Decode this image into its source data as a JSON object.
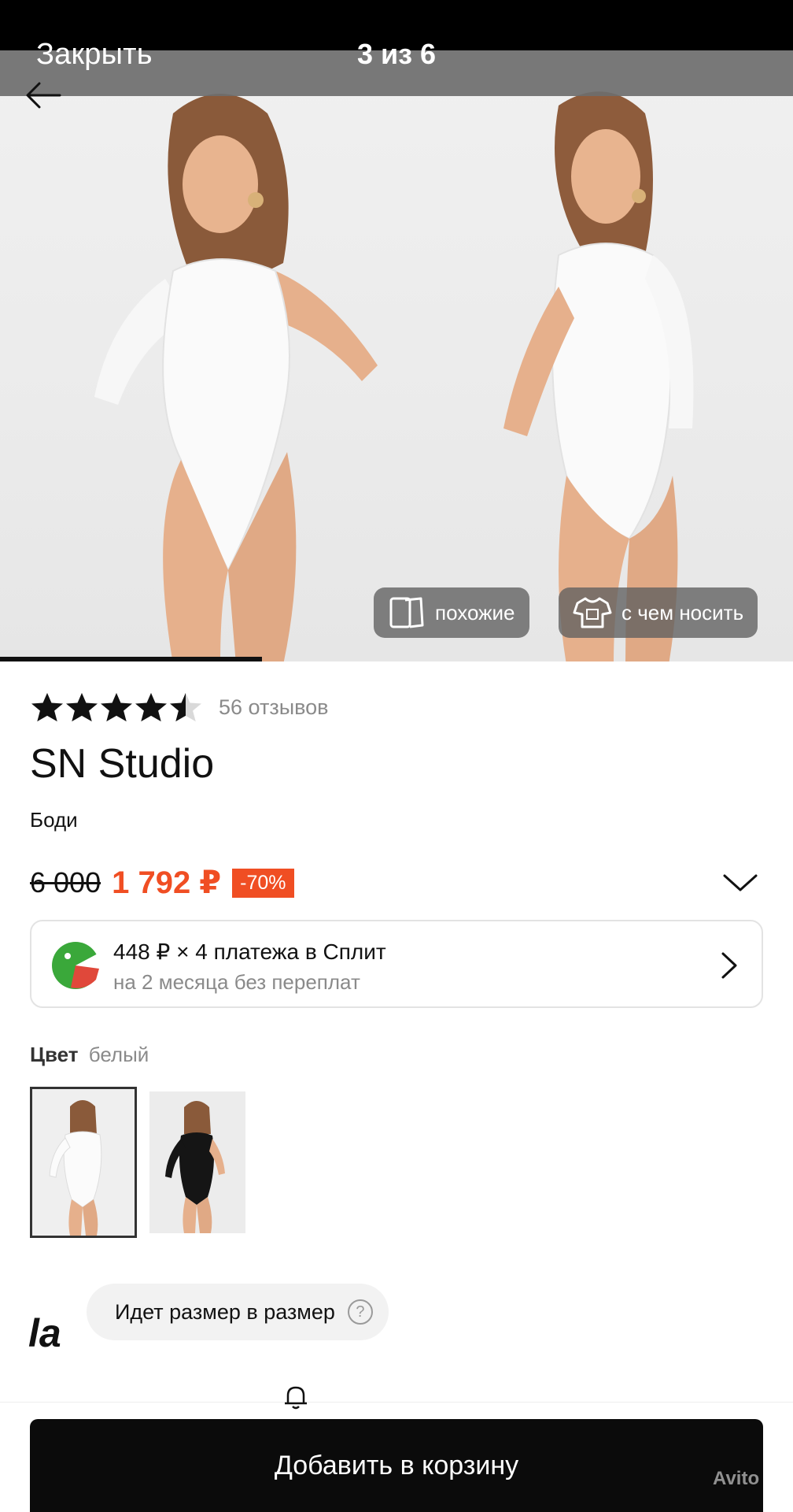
{
  "viewer": {
    "close_label": "Закрыть",
    "counter": "3 из 6",
    "progress_fraction": 0.33
  },
  "photo_actions": {
    "similar_label": "похожие",
    "wear_with_label": "с чем носить"
  },
  "product": {
    "rating_value": 4.5,
    "reviews": "56 отзывов",
    "brand": "SN Studio",
    "category": "Боди",
    "old_price": "6 000",
    "new_price": "1 792 ₽",
    "discount": "-70%"
  },
  "split": {
    "title": "448 ₽ × 4 платежа в Сплит",
    "subtitle": "на 2 месяца без переплат"
  },
  "color": {
    "label": "Цвет",
    "value": "белый",
    "options": [
      "white",
      "black"
    ]
  },
  "size": {
    "logo": "la",
    "hint": "Идет размер в размер",
    "help_icon": "?"
  },
  "cart": {
    "button_label": "Добавить в корзину"
  },
  "watermark": "Avito",
  "colors": {
    "accent": "#f04e23",
    "button": "#0b0b0b",
    "split_green": "#3aa83a"
  }
}
